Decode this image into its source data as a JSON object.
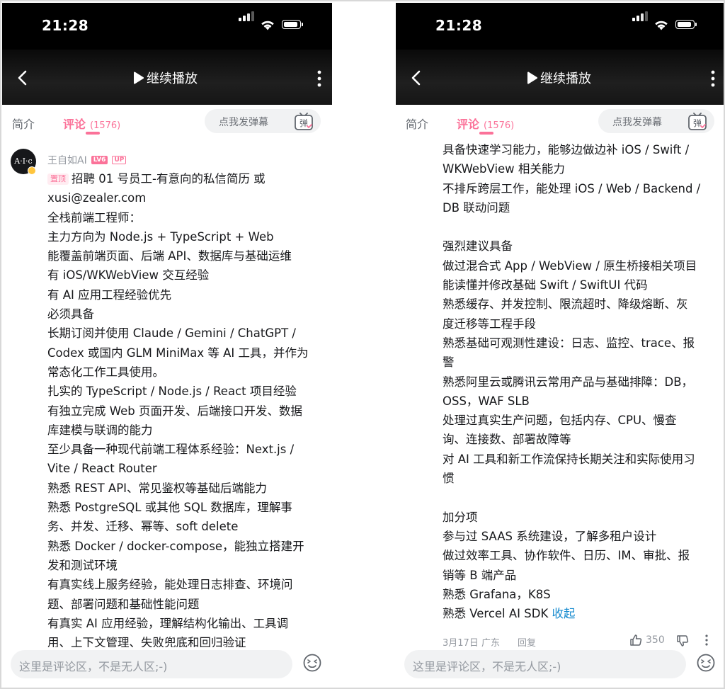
{
  "status": {
    "time": "21:28"
  },
  "topbar": {
    "continue_label": "继续播放"
  },
  "tabs": {
    "intro": "简介",
    "comments": "评论",
    "comment_count": "(1576)"
  },
  "danmaku": {
    "placeholder": "点我发弹幕",
    "icon_text": "弹"
  },
  "comment": {
    "avatar_text": "A·I·c",
    "author": "王自如AI",
    "level_badge": "LV6",
    "up_badge": "UP",
    "pin_badge": "置顶",
    "left_lines": [
      "招聘 01 号员工-有意向的私信简历 或",
      "xusi@zealer.com",
      "全栈前端工程师：",
      "主力方向为 Node.js + TypeScript + Web",
      "能覆盖前端页面、后端 API、数据库与基础运维",
      "有 iOS/WKWebView 交互经验",
      "有 AI 应用工程经验优先",
      "必须具备",
      "长期订阅并使用 Claude / Gemini / ChatGPT /",
      "Codex 或国内 GLM MiniMax 等 AI 工具，并作为",
      "常态化工作工具使用。",
      "扎实的 TypeScript / Node.js / React 项目经验",
      "有独立完成 Web 页面开发、后端接口开发、数据",
      "库建模与联调的能力",
      "至少具备一种现代前端工程体系经验：Next.js /",
      "Vite / React Router",
      "熟悉 REST API、常见鉴权等基础后端能力",
      "熟悉 PostgreSQL 或其他 SQL 数据库，理解事",
      "务、并发、迁移、幂等、soft delete",
      "熟悉 Docker / docker-compose，能独立搭建开",
      "发和测试环境",
      "有真实线上服务经验，能处理日志排查、环境问",
      "题、部署问题和基础性能问题",
      "有真实 AI 应用经验，理解结构化输出、工具调",
      "用、上下文管理、失败兜底和回归验证"
    ],
    "right_lines": [
      "具备快速学习能力，能够边做边补 iOS / Swift /",
      "WKWebView 相关能力",
      "不排斥跨层工作，能处理 iOS / Web / Backend /",
      "DB 联动问题",
      "",
      "强烈建议具备",
      "做过混合式 App / WebView / 原生桥接相关项目",
      "能读懂并修改基础 Swift / SwiftUI 代码",
      "熟悉缓存、并发控制、限流超时、降级熔断、灰",
      "度迁移等工程手段",
      "熟悉基础可观测性建设：日志、监控、trace、报",
      "警",
      "熟悉阿里云或腾讯云常用产品与基础排障：DB，",
      "OSS，WAF SLB",
      "处理过真实生产问题，包括内存、CPU、慢查",
      "询、连接数、部署故障等",
      "对 AI 工具和新工作流保持长期关注和实际使用习",
      "惯",
      "",
      "加分项",
      "参与过 SAAS 系统建设，了解多租户设计",
      "做过效率工具、协作软件、日历、IM、审批、报",
      "销等 B 端产品",
      "熟悉 Grafana，K8S"
    ],
    "last_line": "熟悉 Vercel AI SDK",
    "collapse": "收起",
    "date": "3月17日 广东",
    "reply": "回复",
    "likes": "350"
  },
  "bottom": {
    "placeholder": "这里是评论区，不是无人区;-)"
  },
  "colors": {
    "accent": "#fb7299",
    "link": "#178bcf",
    "meta": "#9499a0"
  },
  "icons": [
    "back-icon",
    "play-icon",
    "more-icon",
    "danmaku-icon",
    "like-icon",
    "dislike-icon",
    "emoji-icon",
    "signal-icon",
    "wifi-icon",
    "battery-icon"
  ]
}
